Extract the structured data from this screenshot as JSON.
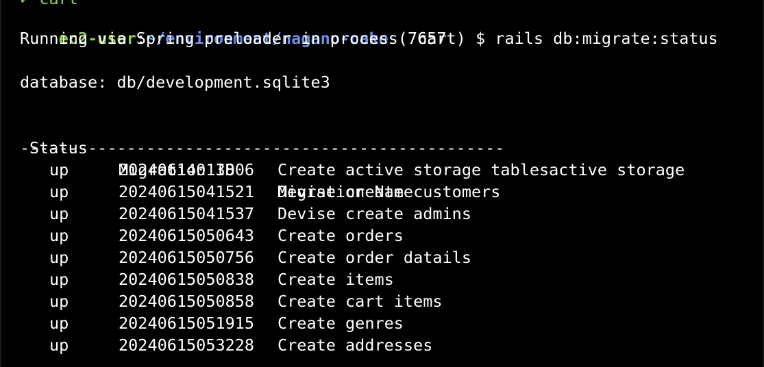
{
  "terminal": {
    "previous_line_fragment": "✓ cart",
    "prompt": {
      "user": "ec2-user",
      "separator": ":",
      "path": "~/environment/nagano-cake",
      "branch": " ( cart) $ ",
      "command": "rails db:migrate:status"
    },
    "spring_line": "Running via Spring preloader in process 7657",
    "database_line": "database: db/development.sqlite3",
    "table": {
      "headers": {
        "status": "Status",
        "migration_id": "Migration ID",
        "migration_name": "Migration Name"
      },
      "separator": "--------------------------------------------------",
      "rows": [
        {
          "status": "up",
          "id": "20240614013806",
          "name": "Create active storage tablesactive storage"
        },
        {
          "status": "up",
          "id": "20240615041521",
          "name": "Devise create customers"
        },
        {
          "status": "up",
          "id": "20240615041537",
          "name": "Devise create admins"
        },
        {
          "status": "up",
          "id": "20240615050643",
          "name": "Create orders"
        },
        {
          "status": "up",
          "id": "20240615050756",
          "name": "Create order datails"
        },
        {
          "status": "up",
          "id": "20240615050838",
          "name": "Create items"
        },
        {
          "status": "up",
          "id": "20240615050858",
          "name": "Create cart items"
        },
        {
          "status": "up",
          "id": "20240615051915",
          "name": "Create genres"
        },
        {
          "status": "up",
          "id": "20240615053228",
          "name": "Create addresses"
        }
      ]
    }
  }
}
